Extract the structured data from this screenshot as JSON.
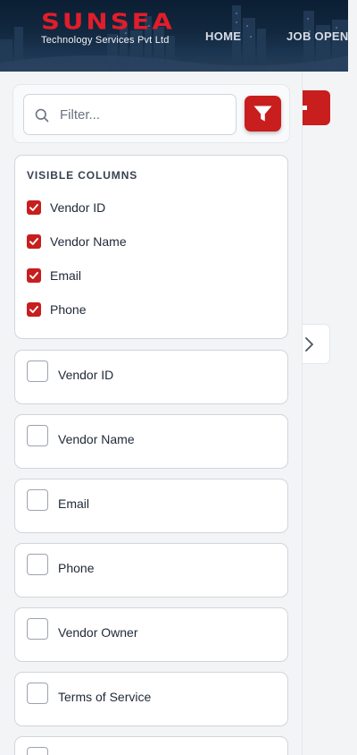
{
  "header": {
    "logo_text": "SUNSEA",
    "logo_subtitle": "Technology Services Pvt Ltd",
    "nav": [
      {
        "label": "HOME"
      },
      {
        "label": "JOB OPENI"
      }
    ]
  },
  "filter": {
    "placeholder": "Filter...",
    "value": "",
    "search_icon": "search-icon",
    "button_icon": "filter-funnel-icon"
  },
  "visible_columns": {
    "title": "VISIBLE COLUMNS",
    "items": [
      {
        "label": "Vendor ID",
        "checked": true
      },
      {
        "label": "Vendor Name",
        "checked": true
      },
      {
        "label": "Email",
        "checked": true
      },
      {
        "label": "Phone",
        "checked": true
      }
    ]
  },
  "column_options": [
    {
      "label": "Vendor ID",
      "checked": false
    },
    {
      "label": "Vendor Name",
      "checked": false
    },
    {
      "label": "Email",
      "checked": false
    },
    {
      "label": "Phone",
      "checked": false
    },
    {
      "label": "Vendor Owner",
      "checked": false
    },
    {
      "label": "Terms of Service",
      "checked": false
    },
    {
      "label": "",
      "checked": false
    }
  ],
  "colors": {
    "accent": "#c81e1e",
    "brand_red": "#e11d2a",
    "header_bg": "#12283f"
  }
}
